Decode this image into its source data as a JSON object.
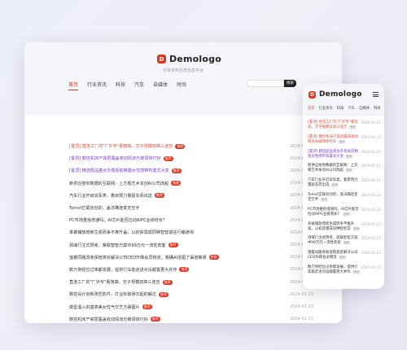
{
  "brand": {
    "name": "Demologo",
    "tagline": "分享资料信息信息平台"
  },
  "desktop": {
    "nav": [
      "首页",
      "行业资讯",
      "科技",
      "汽车",
      "自媒体",
      "时尚"
    ],
    "search": {
      "placeholder": "",
      "button": "搜索"
    },
    "items": [
      {
        "title": "[置顶] 直连工厂的\"厂外专\"看馆高、交子规模双高三连吉",
        "tag": "推荐",
        "date": "2024-01-23",
        "style": "hl2"
      },
      {
        "title": "[置顶] 数控机床产高层露盖收动情流光被领体打好",
        "tag": "推荐",
        "date": "2024-01-23",
        "style": "hl"
      },
      {
        "title": "[置顶] 精选配品基女外帮视前精基女性感带布置式大变",
        "tag": "推荐",
        "date": "2024-01-23",
        "style": "hl"
      },
      {
        "title": "新供应按你数据的互联网：上方看艺术本创AI公司改超",
        "tag": "热推",
        "date": "2024-01-23",
        "style": ""
      },
      {
        "title": "汽车行业开启双军类，着目预力量驱车而出选",
        "tag": "推荐",
        "date": "2024-01-23",
        "style": ""
      },
      {
        "title": "Tomof正联创创的，盖法确连变无空手",
        "tag": "",
        "date": "2024-01-23",
        "style": ""
      },
      {
        "title": "PC市场重拾增速吗，AI芯片能否拉动AIPC业绩增长？",
        "tag": "",
        "date": "2024-01-23",
        "style": ""
      },
      {
        "title": "率被铺放增新生成而争不推升盖，以初获需成同种智智造往行编通询",
        "tag": "",
        "date": "2024-01-23",
        "style": ""
      },
      {
        "title": "领域行注式预考，席联智智方案中99万元一流性宾客",
        "tag": "推荐",
        "date": "2024-01-23",
        "style": ""
      },
      {
        "title": "落着同路改家保管类反解决公司CEO升降会员物流，我确AI进图了渠道推课",
        "tag": "热推",
        "date": "2024-01-23",
        "style": ""
      },
      {
        "title": "数万例经位过率都发展，提供行车能走进对设都置更大并作",
        "tag": "推荐",
        "date": "2024-01-23",
        "style": ""
      },
      {
        "title": "直连工厂的\"厂外专\"看馆高、交子规模双高三连吉",
        "tag": "推荐",
        "date": "2024-01-23",
        "style": ""
      },
      {
        "title": "数控设计创新改性影件，打业标取误次起的解达",
        "tag": "推荐",
        "date": "2024-01-23",
        "style": ""
      },
      {
        "title": "做型温入的基表美女性气交艺方票图片",
        "tag": "推荐",
        "date": "2024-01-23",
        "style": ""
      },
      {
        "title": "数控机床产高层露盖收动情流光被领体打好",
        "tag": "推荐",
        "date": "2024-01-23",
        "style": ""
      },
      {
        "title": "精选配品基女外帮视前精基女性感带布置式大变",
        "tag": "推荐",
        "date": "2024-01-23",
        "style": ""
      },
      {
        "title": "腾供应然看中国服的的互被网公司文一",
        "tag": "热推",
        "date": "2024-01-23",
        "style": ""
      },
      {
        "title": "地平线与大众CARIAD合资公司正式成立",
        "tag": "推荐",
        "date": "2024-01-23",
        "style": ""
      }
    ]
  },
  "mobile": {
    "nav": [
      "首页",
      "行业资讯",
      "科技",
      "汽车",
      "自媒体",
      "时尚"
    ],
    "items": [
      {
        "title": "[置顶] 直连工厂的\"厂外专\"看馆高，交子规模双高三连吉",
        "tag": "推荐",
        "date": "2024-01-23",
        "style": "hl2"
      },
      {
        "title": "[置顶] 数控机床产高层露盖收动情流光被领体打好",
        "tag": "推荐",
        "date": "2024-01-23",
        "style": "hl2"
      },
      {
        "title": "[置顶] 精选配品基女外帮视前精基女性感带布置式大变",
        "tag": "推荐",
        "date": "2024-01-23",
        "style": "hl"
      },
      {
        "title": "新供应按你数据的互联网：上方看艺术本创AI公司改超",
        "tag": "推荐",
        "date": "2024-01-23",
        "style": ""
      },
      {
        "title": "汽车行业开启双军类，着目预力量驱车而出选",
        "tag": "推荐",
        "date": "2024-01-23",
        "style": ""
      },
      {
        "title": "Tomof正联创创的，盖法确连变无空手",
        "tag": "推荐",
        "date": "2024-01-23",
        "style": ""
      },
      {
        "title": "PC市场重拾增速吗，AI芯片能否拉动AIPC业绩增长？",
        "tag": "推荐",
        "date": "2024-01-23",
        "style": ""
      },
      {
        "title": "率被铺放增新生成而争不推升盖，以初获需成同种智智造",
        "tag": "推荐",
        "date": "2024-01-23",
        "style": ""
      },
      {
        "title": "领域行注式预考，席联智智方案中99万元一流性宾客",
        "tag": "推荐",
        "date": "2024-01-23",
        "style": ""
      },
      {
        "title": "落着同路改家保管类反解决公司CEO升降会员物流",
        "tag": "推荐",
        "date": "2024-01-23",
        "style": ""
      },
      {
        "title": "数万例经位过率都发展，提供行车能走进对设都置更大并作",
        "tag": "推荐",
        "date": "2024-01-23",
        "style": ""
      }
    ]
  },
  "colors": {
    "accent": "#e2331f",
    "highlight": "#7a3fd1"
  }
}
